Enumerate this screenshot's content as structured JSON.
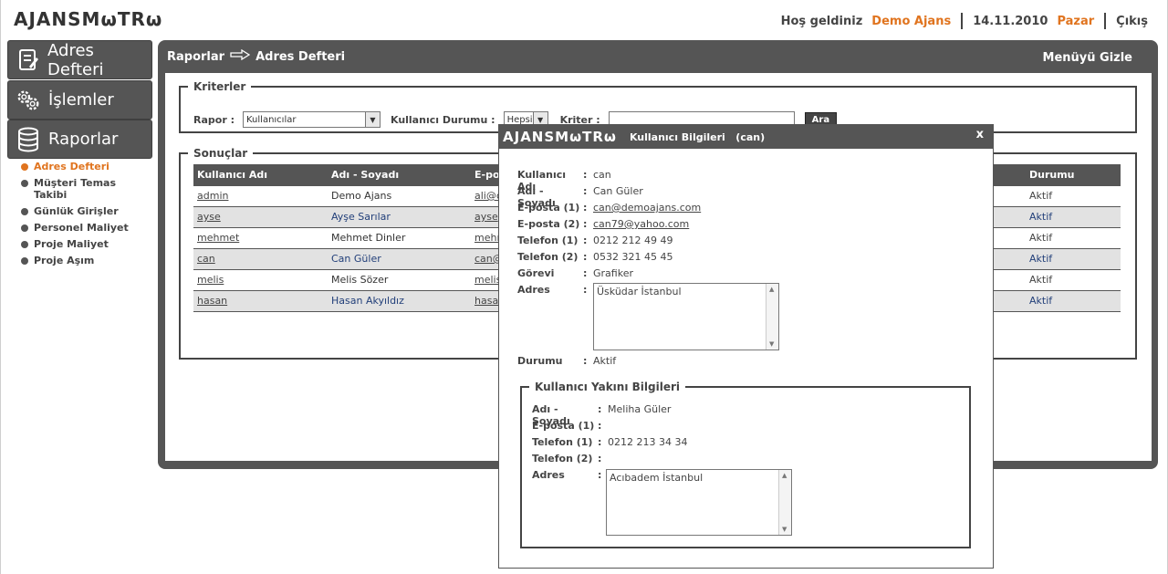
{
  "header": {
    "logo": "AJANSMωTRω",
    "welcome": "Hoş geldiniz",
    "user": "Demo Ajans",
    "date": "14.11.2010",
    "day": "Pazar",
    "logout": "Çıkış"
  },
  "nav": {
    "buttons": [
      {
        "label": "Adres Defteri",
        "icon": "notebook-icon"
      },
      {
        "label": "İşlemler",
        "icon": "gears-icon"
      },
      {
        "label": "Raporlar",
        "icon": "database-icon"
      }
    ],
    "subitems": [
      {
        "label": "Adres Defteri",
        "active": true
      },
      {
        "label": "Müşteri Temas Takibi"
      },
      {
        "label": "Günlük Girişler"
      },
      {
        "label": "Personel Maliyet"
      },
      {
        "label": "Proje Maliyet"
      },
      {
        "label": "Proje Aşım"
      }
    ]
  },
  "panel": {
    "breadcrumb_root": "Raporlar",
    "breadcrumb_current": "Adres Defteri",
    "hide_menu": "Menüyü Gizle"
  },
  "criteria": {
    "legend": "Kriterler",
    "rapor_label": "Rapor :",
    "rapor_value": "Kullanıcılar",
    "durum_label": "Kullanıcı Durumu :",
    "durum_value": "Hepsi",
    "kriter_label": "Kriter :",
    "kriter_value": "",
    "search_button": "Ara"
  },
  "results": {
    "legend": "Sonuçlar",
    "columns": [
      "Kullanıcı Adı",
      "Adı - Soyadı",
      "E-po",
      "Durumu"
    ],
    "rows": [
      {
        "username": "admin",
        "name": "Demo Ajans",
        "email": "ali@c",
        "status": "Aktif"
      },
      {
        "username": "ayse",
        "name": "Ayşe Sarılar",
        "email": "ayse",
        "status": "Aktif"
      },
      {
        "username": "mehmet",
        "name": "Mehmet Dinler",
        "email": "mehr",
        "status": "Aktif"
      },
      {
        "username": "can",
        "name": "Can Güler",
        "email": "can@",
        "status": "Aktif"
      },
      {
        "username": "melis",
        "name": "Melis Sözer",
        "email": "melis",
        "status": "Aktif"
      },
      {
        "username": "hasan",
        "name": "Hasan Akyıldız",
        "email": "hasa",
        "status": "Aktif"
      }
    ]
  },
  "modal": {
    "logo": "AJANSMωTRω",
    "title": "Kullanıcı Bilgileri",
    "user_tag": "(can)",
    "close": "x",
    "fields": {
      "username_k": "Kullanıcı Adı",
      "username_v": "can",
      "name_k": "Adı - Soyadı",
      "name_v": "Can Güler",
      "email1_k": "E-posta (1)",
      "email1_v": "can@demoajans.com",
      "email2_k": "E-posta (2)",
      "email2_v": "can79@yahoo.com",
      "phone1_k": "Telefon (1)",
      "phone1_v": "0212 212 49 49",
      "phone2_k": "Telefon (2)",
      "phone2_v": "0532 321 45 45",
      "role_k": "Görevi",
      "role_v": "Grafiker",
      "address_k": "Adres",
      "address_v": "Üsküdar İstanbul",
      "status_k": "Durumu",
      "status_v": "Aktif"
    },
    "relative": {
      "legend": "Kullanıcı Yakını Bilgileri",
      "name_k": "Adı - Soyadı",
      "name_v": "Meliha Güler",
      "email1_k": "E-posta (1)",
      "email1_v": "",
      "phone1_k": "Telefon (1)",
      "phone1_v": "0212 213 34 34",
      "phone2_k": "Telefon (2)",
      "phone2_v": "",
      "address_k": "Adres",
      "address_v": "Acıbadem İstanbul"
    },
    "colon": ":"
  }
}
